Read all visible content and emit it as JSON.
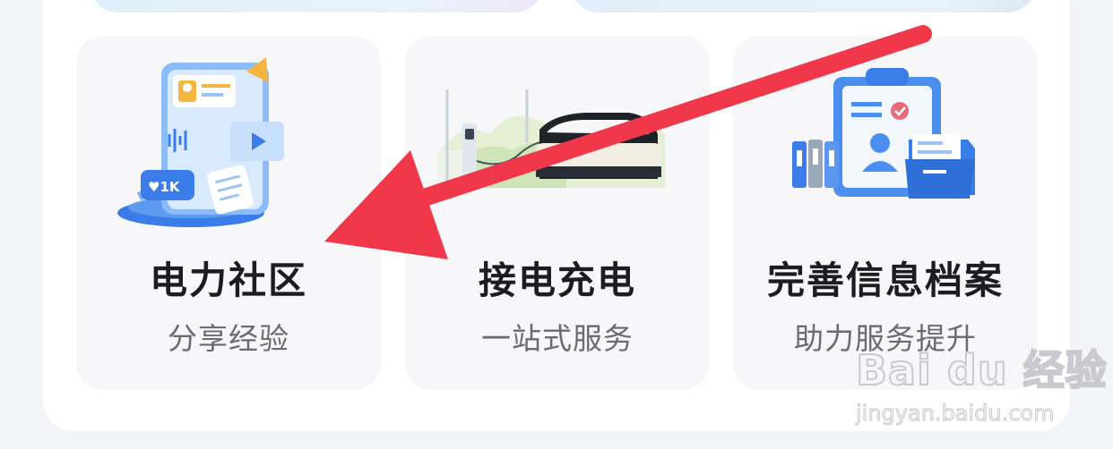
{
  "cards": [
    {
      "title": "电力社区",
      "subtitle": "分享经验",
      "illustration": "community-phone-illustration"
    },
    {
      "title": "接电充电",
      "subtitle": "一站式服务",
      "illustration": "ev-charging-illustration"
    },
    {
      "title": "完善信息档案",
      "subtitle": "助力服务提升",
      "illustration": "clipboard-archive-illustration"
    }
  ],
  "illustration_badges": {
    "likes": "1K"
  },
  "annotation": {
    "arrow_color": "#f0384a",
    "points_to": "电力社区"
  },
  "watermark": {
    "logo": "Bai du 经验",
    "url": "jingyan.baidu.com"
  }
}
